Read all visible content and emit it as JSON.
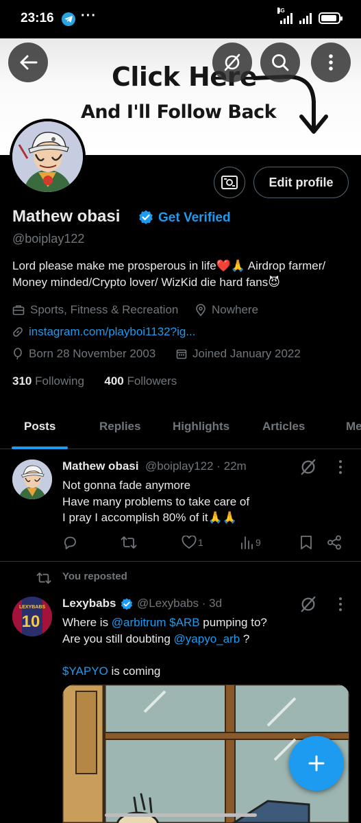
{
  "status_bar": {
    "time": "23:16",
    "network": "4G"
  },
  "banner": {
    "line1": "Click Here",
    "line2": "And I'll Follow Back"
  },
  "profile": {
    "name": "Mathew obasi",
    "get_verified": "Get Verified",
    "handle": "@boiplay122",
    "bio": "Lord please make me prosperous in life❤️🙏 Airdrop farmer/ Money minded/Crypto lover/ WizKid die hard fans😈",
    "category": "Sports, Fitness & Recreation",
    "location": "Nowhere",
    "website": "instagram.com/playboi1132?ig...",
    "born": "Born 28 November 2003",
    "joined": "Joined January 2022",
    "following_count": "310",
    "following_label": "Following",
    "followers_count": "400",
    "followers_label": "Followers",
    "edit_label": "Edit profile"
  },
  "tabs": [
    "Posts",
    "Replies",
    "Highlights",
    "Articles",
    "Me"
  ],
  "posts": [
    {
      "name": "Mathew obasi",
      "handle": "@boiplay122",
      "time": "· 22m",
      "lines": [
        "Not gonna fade anymore",
        "Have many problems to take care of",
        "I pray I accomplish 80% of it🙏🙏"
      ],
      "likes": "1",
      "views": "9"
    },
    {
      "repost_label": "You reposted",
      "name": "Lexybabs",
      "handle": "@Lexybabs",
      "time": "· 3d",
      "line1_pre": "Where is ",
      "line1_link1": "@arbitrum",
      "line1_link2": "$ARB",
      "line1_post": " pumping to?",
      "line2_pre": "Are you still doubting ",
      "line2_link": "@yapyo_arb",
      "line2_post": " ?",
      "line3_link": "$YAPYO",
      "line3_post": " is coming",
      "jersey_number": "10",
      "jersey_text": "LEXYBABS"
    }
  ],
  "colors": {
    "accent": "#1d9bf0",
    "muted": "#71767b",
    "text": "#e7e9ea",
    "background": "#000000"
  }
}
